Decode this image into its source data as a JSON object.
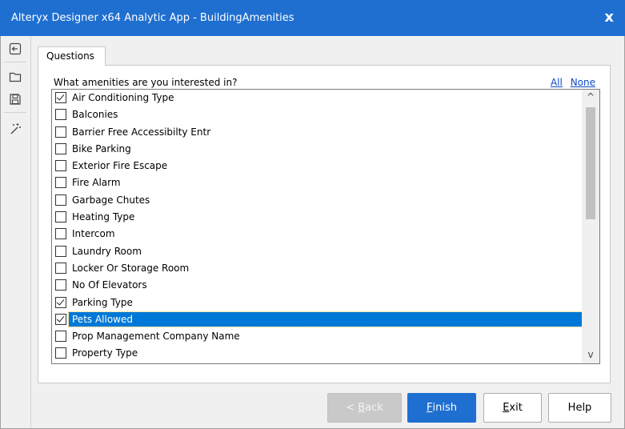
{
  "window": {
    "title": "Alteryx Designer x64 Analytic App - BuildingAmenities",
    "close_label": "x"
  },
  "sidebar": {
    "icons": [
      "back-icon",
      "folder-icon",
      "save-icon",
      "magic-wand-icon"
    ]
  },
  "tab": {
    "label": "Questions"
  },
  "question": {
    "text": "What amenities are you interested in?",
    "all_label": "All",
    "none_label": "None"
  },
  "amenities": [
    {
      "label": "Air Conditioning Type",
      "checked": true,
      "selected": false
    },
    {
      "label": "Balconies",
      "checked": false,
      "selected": false
    },
    {
      "label": "Barrier Free Accessibilty Entr",
      "checked": false,
      "selected": false
    },
    {
      "label": "Bike Parking",
      "checked": false,
      "selected": false
    },
    {
      "label": "Exterior Fire Escape",
      "checked": false,
      "selected": false
    },
    {
      "label": "Fire Alarm",
      "checked": false,
      "selected": false
    },
    {
      "label": "Garbage Chutes",
      "checked": false,
      "selected": false
    },
    {
      "label": "Heating Type",
      "checked": false,
      "selected": false
    },
    {
      "label": "Intercom",
      "checked": false,
      "selected": false
    },
    {
      "label": "Laundry Room",
      "checked": false,
      "selected": false
    },
    {
      "label": "Locker Or Storage Room",
      "checked": false,
      "selected": false
    },
    {
      "label": "No Of Elevators",
      "checked": false,
      "selected": false
    },
    {
      "label": "Parking Type",
      "checked": true,
      "selected": false
    },
    {
      "label": "Pets Allowed",
      "checked": true,
      "selected": true
    },
    {
      "label": "Prop Management Company Name",
      "checked": false,
      "selected": false
    },
    {
      "label": "Property Type",
      "checked": false,
      "selected": false
    }
  ],
  "scroll": {
    "up_glyph": "^",
    "down_glyph": "v"
  },
  "buttons": {
    "back": {
      "prefix": "< ",
      "mnemonic": "B",
      "rest": "ack"
    },
    "finish": {
      "mnemonic": "F",
      "rest": "inish"
    },
    "exit": {
      "mnemonic": "E",
      "rest": "xit"
    },
    "help": {
      "label": "Help"
    }
  },
  "colors": {
    "titlebar": "#1f6fd1",
    "selection": "#0078d7",
    "link": "#0b48c8"
  }
}
